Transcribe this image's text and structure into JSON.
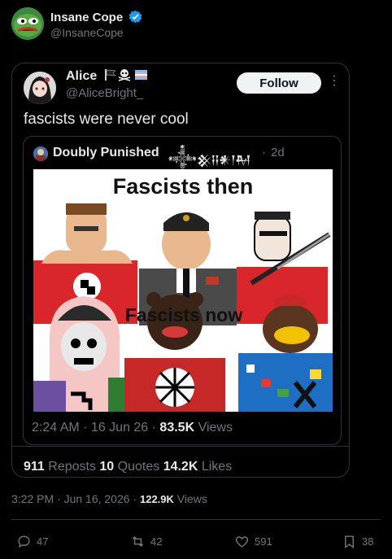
{
  "outer": {
    "name": "Insane Cope",
    "handle": "@InsaneCope",
    "timestamp": "3:22 PM · Jun 16, 2026 · ",
    "views": "122.9K",
    "views_label": " Views",
    "actions": {
      "replies": "47",
      "reposts": "42",
      "likes": "591",
      "bookmarks": "38"
    }
  },
  "embedded": {
    "name": "Alice",
    "handle": "@AliceBright_",
    "follow_label": "Follow",
    "text": "fascists were never cool",
    "timestamp": "2:24 AM · 16 Jun 26 · ",
    "views": "83.5K",
    "views_label": " Views",
    "reposts": "911",
    "reposts_label": " Reposts ",
    "quotes": "10",
    "quotes_label": " Quotes ",
    "likes": "14.2K",
    "likes_label": " Likes"
  },
  "quoted": {
    "name": "Doubly Punished",
    "glyphs": "𒀱𒆜𒍝𒀭𒁹𒈹",
    "separator": "·",
    "time": "2d",
    "meme_title_top": "Fascists then",
    "meme_title_bottom": "Fascists now"
  },
  "colors": {
    "background": "#000000",
    "text": "#e7e9ea",
    "muted": "#71767b",
    "border": "#2f3336",
    "verified": "#1d9bf0"
  }
}
